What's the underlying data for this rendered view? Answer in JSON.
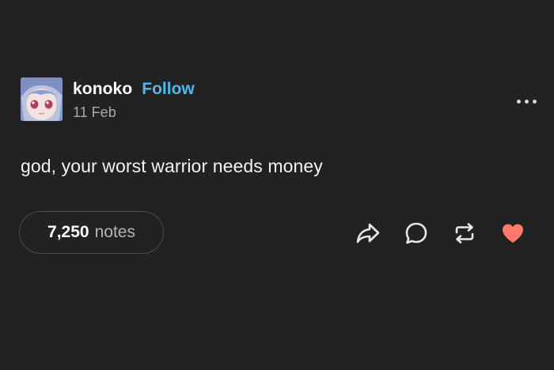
{
  "post": {
    "author": "konoko",
    "follow_label": "Follow",
    "date": "11 Feb",
    "body": "god, your worst warrior needs money",
    "notes_count": "7,250",
    "notes_label": "notes"
  },
  "icons": {
    "more": "more-options-icon",
    "share": "share-icon",
    "reply": "reply-icon",
    "reblog": "reblog-icon",
    "like": "heart-icon"
  },
  "colors": {
    "background": "#222222",
    "follow": "#4fb9ec",
    "heart": "#ff7a6b",
    "muted_text": "#a8a8a8"
  }
}
